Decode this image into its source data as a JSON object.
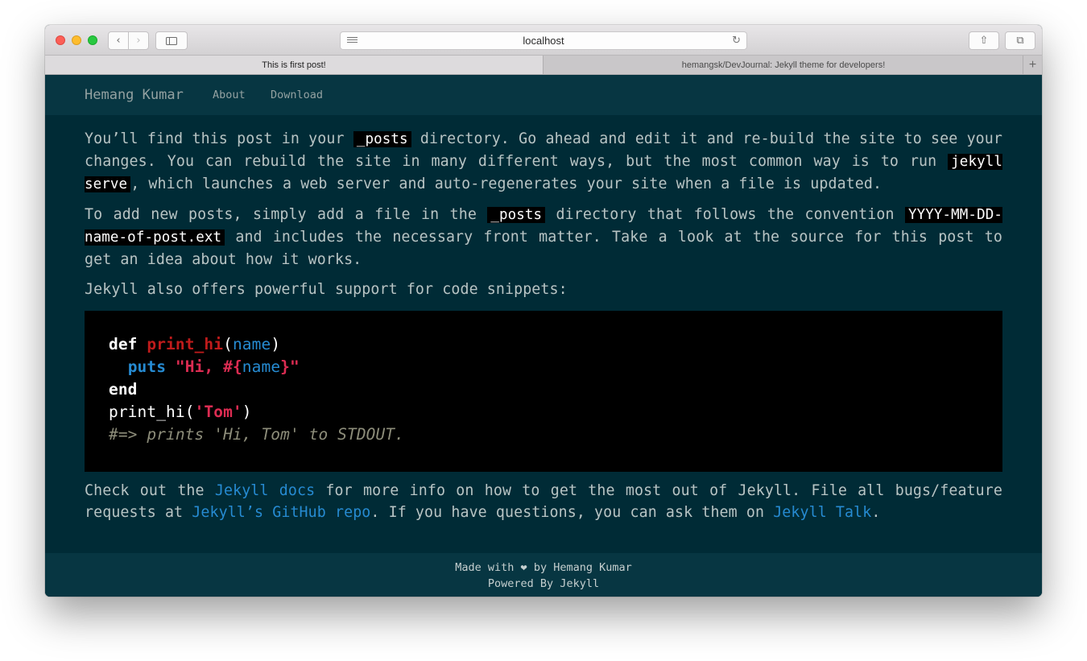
{
  "browser": {
    "url": "localhost",
    "tabs": [
      {
        "label": "This is first post!"
      },
      {
        "label": "hemangsk/DevJournal: Jekyll theme for developers!"
      }
    ],
    "new_tab_label": "+"
  },
  "site": {
    "brand": "Hemang Kumar",
    "nav": [
      {
        "label": "About"
      },
      {
        "label": "Download"
      }
    ]
  },
  "post": {
    "p1": {
      "t1": "You’ll find this post in your ",
      "code1": "_posts",
      "t2": " directory. Go ahead and edit it and re-build the site to see your changes. You can rebuild the site in many different ways, but the most common way is to run ",
      "code2": "jekyll serve",
      "t3": ", which launches a web server and auto-regenerates your site when a file is updated."
    },
    "p2": {
      "t1": "To add new posts, simply add a file in the ",
      "code1": "_posts",
      "t2": " directory that follows the convention ",
      "code2": "YYYY-MM-DD-name-of-post.ext",
      "t3": " and includes the necessary front matter. Take a look at the source for this post to get an idea about how it works."
    },
    "p3": "Jekyll also offers powerful support for code snippets:",
    "code": {
      "l1_kw": "def",
      "l1_fn": "print_hi",
      "l1_open": "(",
      "l1_arg": "name",
      "l1_close": ")",
      "l2_fn": "puts",
      "l2_str1": "\"Hi, #{",
      "l2_arg": "name",
      "l2_str2": "}\"",
      "l3_kw": "end",
      "l4_plain": "print_hi(",
      "l4_str": "'Tom'",
      "l4_close": ")",
      "l5_cmt": "#=> prints 'Hi, Tom' to STDOUT."
    },
    "p4": {
      "t1": "Check out the ",
      "link1": "Jekyll docs",
      "t2": " for more info on how to get the most out of Jekyll. File all bugs/feature requests at ",
      "link2": "Jekyll’s GitHub repo",
      "t3": ". If you have questions, you can ask them on ",
      "link3": "Jekyll Talk",
      "t4": "."
    }
  },
  "footer": {
    "made_prefix": "Made with ",
    "heart_icon": "heart-icon",
    "made_suffix": " by Hemang Kumar",
    "powered": "Powered By Jekyll"
  }
}
